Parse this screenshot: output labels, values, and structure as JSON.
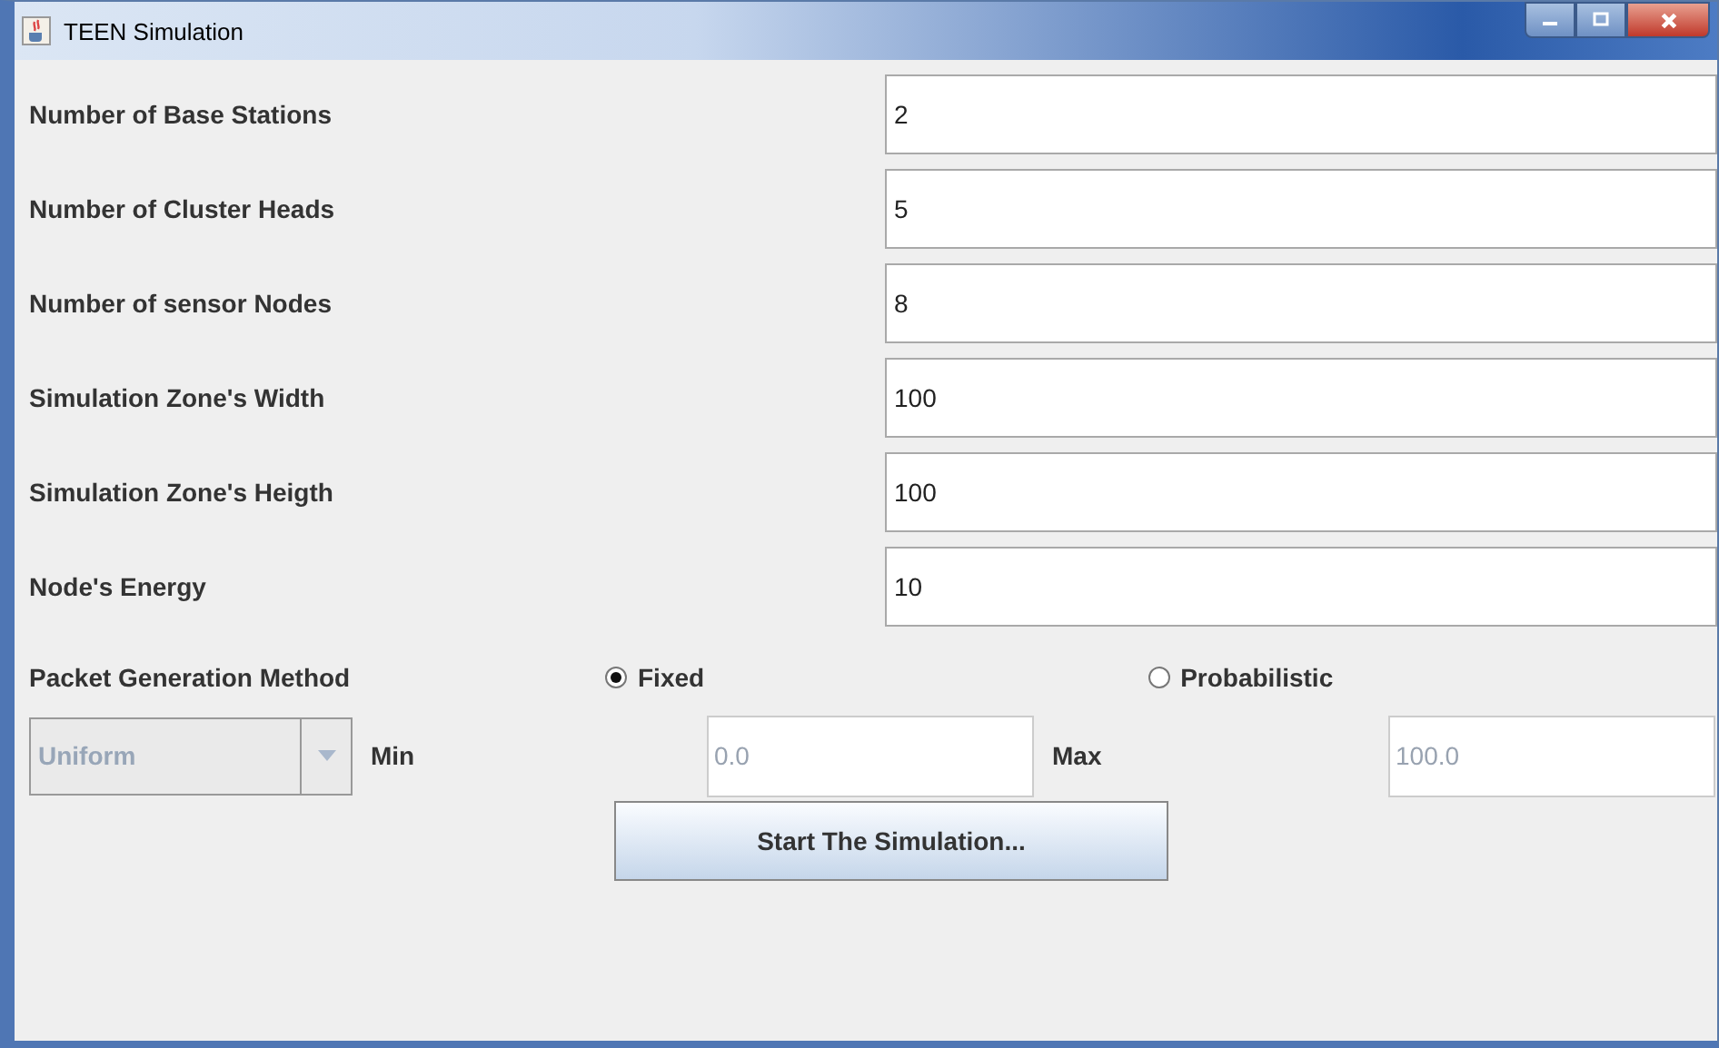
{
  "window": {
    "title": "TEEN Simulation"
  },
  "fields": [
    {
      "label": "Number of Base Stations",
      "value": "2"
    },
    {
      "label": "Number of Cluster Heads",
      "value": "5"
    },
    {
      "label": "Number of sensor Nodes",
      "value": "8"
    },
    {
      "label": "Simulation Zone's Width",
      "value": "100"
    },
    {
      "label": "Simulation Zone's Heigth",
      "value": "100"
    },
    {
      "label": "Node's Energy",
      "value": "10"
    }
  ],
  "packet_method": {
    "label": "Packet Generation Method",
    "options": [
      {
        "label": "Fixed",
        "selected": true
      },
      {
        "label": "Probabilistic",
        "selected": false
      }
    ]
  },
  "distribution": {
    "value": "Uniform",
    "disabled": true
  },
  "min": {
    "label": "Min",
    "value": "0.0",
    "disabled": true
  },
  "max": {
    "label": "Max",
    "value": "100.0",
    "disabled": true
  },
  "start_button": "Start The Simulation..."
}
